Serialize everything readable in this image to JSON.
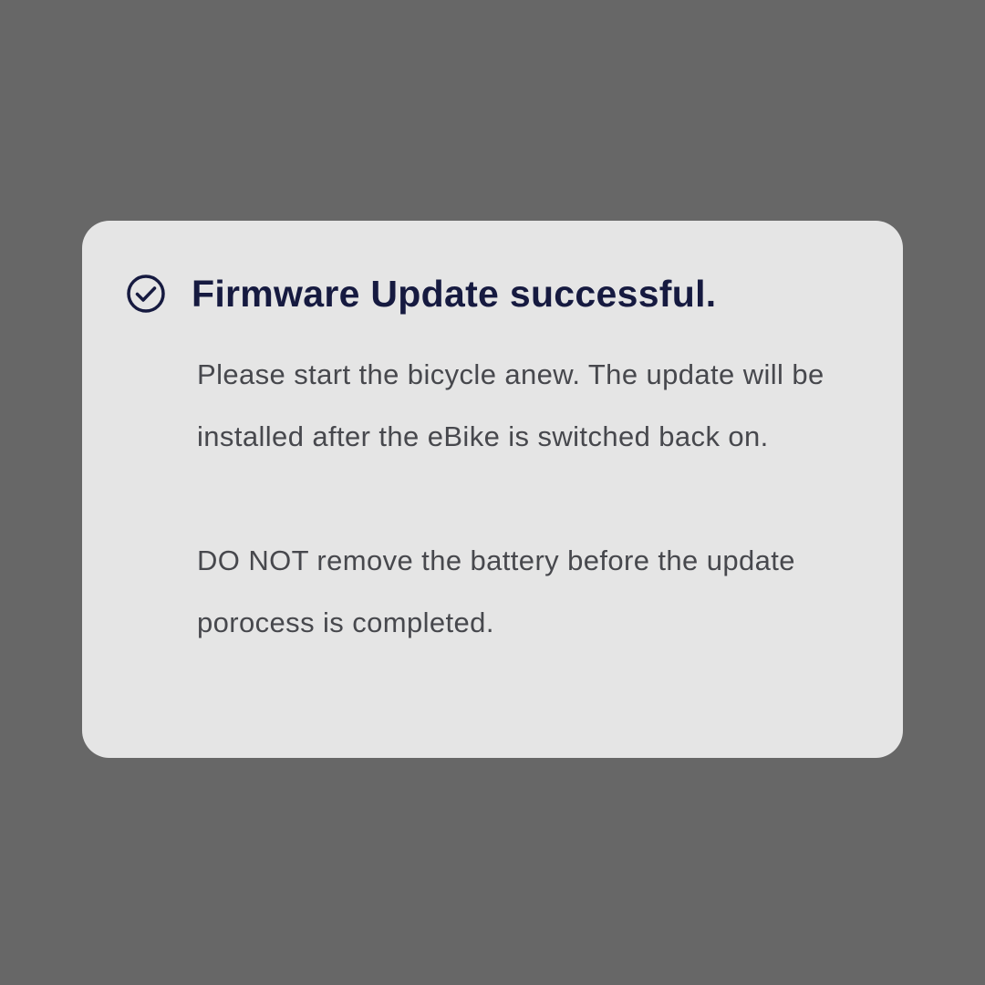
{
  "dialog": {
    "icon": "check-circle-icon",
    "title": "Firmware Update successful.",
    "paragraphs": [
      "Please start the bicycle anew. The update will be installed after the eBike is switched back on.",
      "DO NOT remove the battery before the update porocess is completed."
    ]
  },
  "colors": {
    "backdrop": "#676767",
    "dialog_background": "#e5e5e5",
    "title": "#161a40",
    "body_text": "#47484d"
  }
}
